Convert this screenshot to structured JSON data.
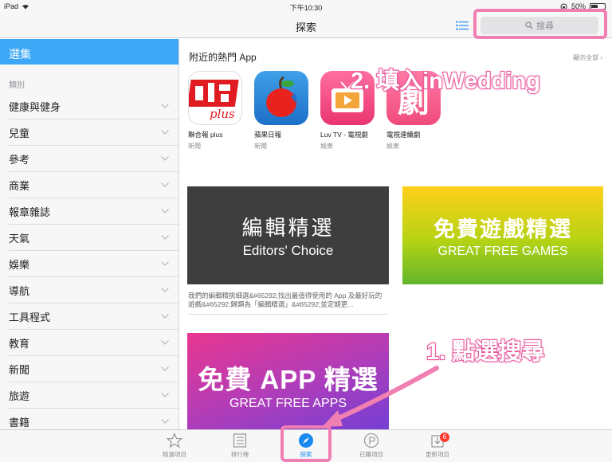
{
  "status_bar": {
    "device": "iPad",
    "time": "下午10:30",
    "battery": "50%",
    "battery_level": 0.5
  },
  "nav": {
    "title": "探索",
    "search_placeholder": "搜尋"
  },
  "sidebar": {
    "selected": "選集",
    "section_label": "類別",
    "items": [
      {
        "label": "健康與健身"
      },
      {
        "label": "兒童"
      },
      {
        "label": "參考"
      },
      {
        "label": "商業"
      },
      {
        "label": "報章雜誌"
      },
      {
        "label": "天氣"
      },
      {
        "label": "娛樂"
      },
      {
        "label": "導航"
      },
      {
        "label": "工具程式"
      },
      {
        "label": "教育"
      },
      {
        "label": "新聞"
      },
      {
        "label": "旅遊"
      },
      {
        "label": "書籍"
      }
    ]
  },
  "main": {
    "nearby_title": "附近的熱門 App",
    "see_all": "顯示全部",
    "apps": [
      {
        "name": "聯合報 plus",
        "category": "新聞",
        "icon_text": "plus"
      },
      {
        "name": "蘋果日報",
        "category": "新聞"
      },
      {
        "name": "Luv TV - 電視劇",
        "category": "娛樂"
      },
      {
        "name": "電視連續劇",
        "category": "娛樂",
        "icon_text": "劇"
      }
    ],
    "banners": [
      {
        "line1": "編輯精選",
        "line2": "Editors' Choice",
        "description": "我們的編輯精挑細選&#65292;找出最值得使用的 App 及最好玩的遊戲&#65292;歸類為「編輯精選」&#65292;並定期更..."
      },
      {
        "line1": "免費遊戲精選",
        "line2": "GREAT FREE GAMES"
      },
      {
        "line1": "免費 APP 精選",
        "line2": "GREAT FREE APPS"
      }
    ]
  },
  "tabs": [
    {
      "label": "精選項目",
      "icon": "star-icon"
    },
    {
      "label": "排行榜",
      "icon": "list-icon"
    },
    {
      "label": "探索",
      "icon": "compass-icon",
      "active": true
    },
    {
      "label": "已購項目",
      "icon": "purchased-icon"
    },
    {
      "label": "更新項目",
      "icon": "updates-icon",
      "badge": "6"
    }
  ],
  "annotations": {
    "step2": "2. 填入inWedding",
    "step1": "1. 點選搜尋",
    "highlight_color": "#f07fb3"
  }
}
